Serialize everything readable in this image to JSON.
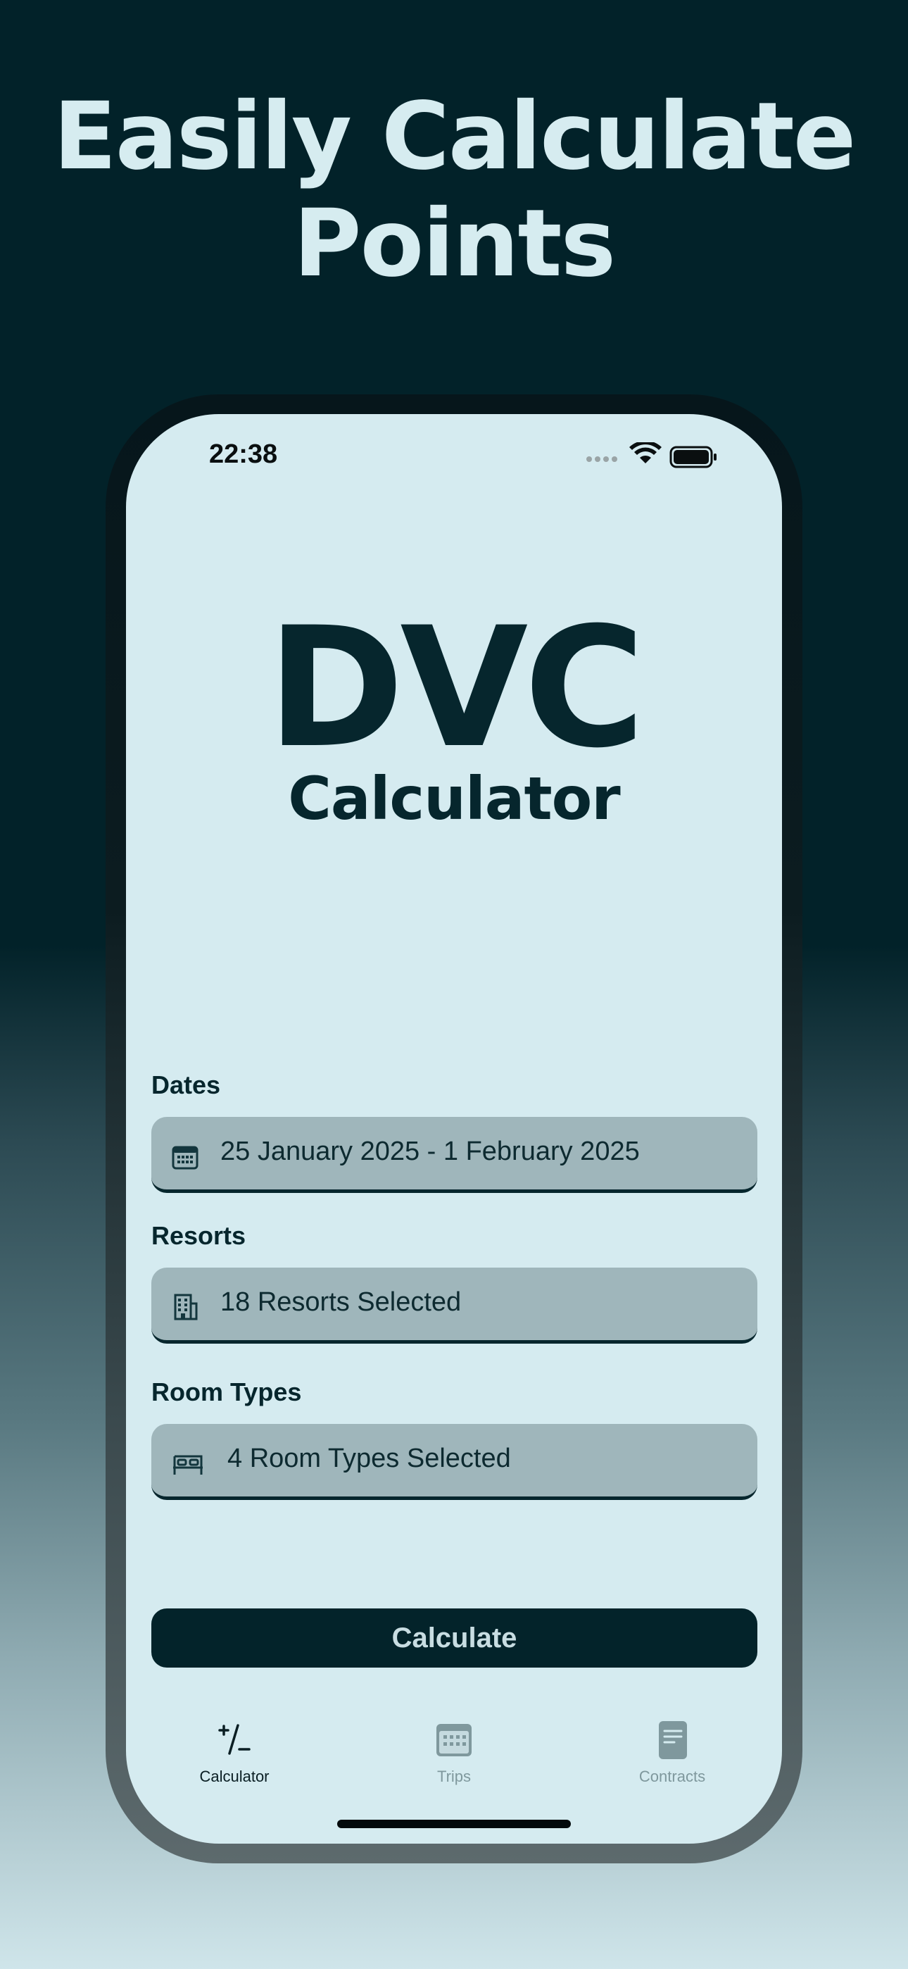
{
  "headline": {
    "line1": "Easily Calculate",
    "line2": "Points"
  },
  "status_bar": {
    "time": "22:38"
  },
  "logo": {
    "title": "DVC",
    "subtitle": "Calculator"
  },
  "form": {
    "dates": {
      "label": "Dates",
      "value": "25 January 2025 - 1 February 2025",
      "icon": "calendar-icon"
    },
    "resorts": {
      "label": "Resorts",
      "value": "18 Resorts Selected",
      "icon": "building-icon"
    },
    "room_types": {
      "label": "Room Types",
      "value": "4 Room Types Selected",
      "icon": "bed-icon"
    }
  },
  "calculate_button": {
    "label": "Calculate"
  },
  "tabs": [
    {
      "label": "Calculator",
      "icon": "plus-slash-minus-icon",
      "active": true
    },
    {
      "label": "Trips",
      "icon": "calendar-icon",
      "active": false
    },
    {
      "label": "Contracts",
      "icon": "document-icon",
      "active": false
    }
  ],
  "colors": {
    "background_top": "#022229",
    "background_bottom": "#cfe5ea",
    "screen": "#d5ebf0",
    "field": "#9fb6bb",
    "accent_dark": "#03232a",
    "tab_inactive": "#7f989d"
  }
}
